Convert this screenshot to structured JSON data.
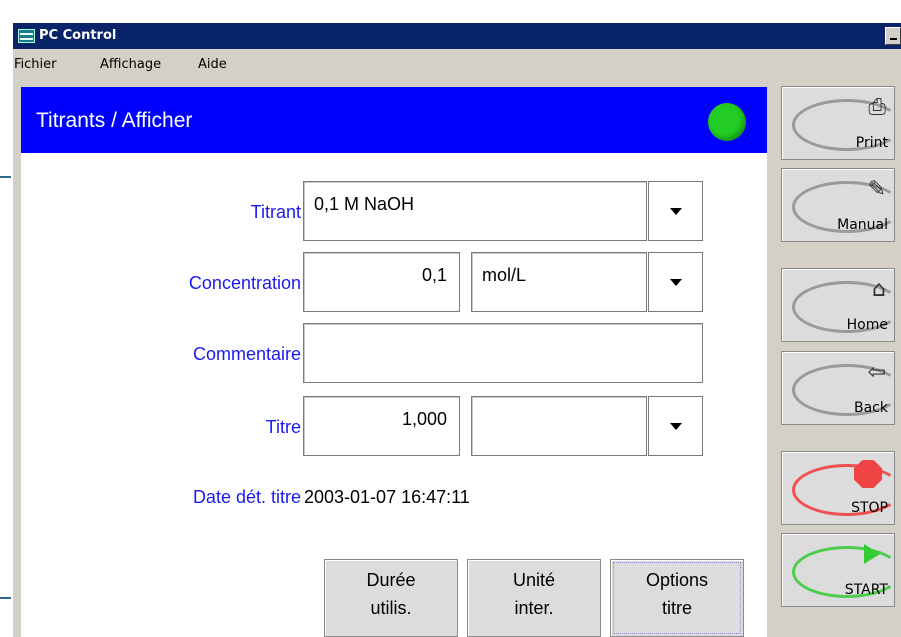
{
  "window": {
    "title": "PC Control"
  },
  "menu": {
    "items": [
      "Fichier",
      "Affichage",
      "Aide"
    ]
  },
  "header": {
    "title": "Titrants / Afficher",
    "status_color": "#22cc22"
  },
  "form": {
    "titrant": {
      "label": "Titrant",
      "value": "0,1 M NaOH"
    },
    "concentration": {
      "label": "Concentration",
      "value": "0,1",
      "unit": "mol/L"
    },
    "comment": {
      "label": "Commentaire",
      "value": ""
    },
    "titre": {
      "label": "Titre",
      "value": "1,000",
      "unit": ""
    },
    "date": {
      "label": "Date dét. titre",
      "value": "2003-01-07 16:47:11"
    }
  },
  "buttons": {
    "duration": {
      "line1": "Durée",
      "line2": "utilis."
    },
    "unit": {
      "line1": "Unité",
      "line2": "inter."
    },
    "options": {
      "line1": "Options",
      "line2": "titre"
    }
  },
  "sidebar": {
    "print": {
      "label": "Print",
      "icon": "printer-icon"
    },
    "manual": {
      "label": "Manual",
      "icon": "manual-icon"
    },
    "home": {
      "label": "Home",
      "icon": "home-icon"
    },
    "back": {
      "label": "Back",
      "icon": "back-arrow-icon"
    },
    "stop": {
      "label": "STOP",
      "icon": "stop-octagon-icon",
      "color": "#ee4444"
    },
    "start": {
      "label": "START",
      "icon": "play-triangle-icon",
      "color": "#33cc33"
    }
  },
  "colors": {
    "header_bg": "#0000ff",
    "label": "#1a1aee",
    "titlebar": "#0a246a"
  }
}
